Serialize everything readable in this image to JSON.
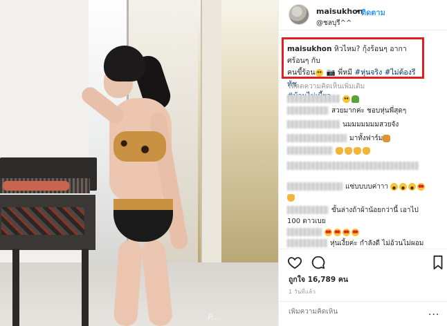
{
  "post": {
    "username": "maisukhon",
    "separator": "•",
    "follow_label": "ติดตาม",
    "location": "@ชลบุรี^^",
    "photo_watermark": "P..."
  },
  "caption": {
    "username": "maisukhon",
    "text_line1": "หิวไหม? กุ้งร้อนๆ อากาศร้อนๆ กับ",
    "text_line2_a": "คนขี้ร้อน",
    "text_line2_b": "📷 พี่หมี",
    "tag1": "#หุ่นจริง",
    "tag2": "#ไม่ต้องรีทัช",
    "tag3": "#บ้านไม่เบี้ยว"
  },
  "load_more": "โหลดความคิดเห็นเพิ่มเติม",
  "comments": [
    {
      "text": ""
    },
    {
      "text": "สวยมากค่ะ ชอบหุ่นพี่สุดๆ"
    },
    {
      "text": "นมมมมมมมสวยจัง"
    },
    {
      "text": "มาทั้งฟาร์ม"
    },
    {
      "text": ""
    },
    {
      "text": "......"
    },
    {
      "text": "แซ่บบบบค่าาา"
    },
    {
      "text": ""
    },
    {
      "text": "ขั้นล่างถ้าผ้าน้อยกว่านี้ เอาไป"
    },
    {
      "text": "100 ดาวเบย"
    },
    {
      "text": ""
    },
    {
      "text": "หุ่นเงี้ยค่ะ กำลังดี ไม่อ้วนไม่ผอม"
    }
  ],
  "likes_text": "ถูกใจ 16,789 คน",
  "time_text": "1 วันที่แล้ว",
  "add_comment_placeholder": "เพิ่มความคิดเห็น",
  "more_label": "...",
  "icons": [
    "heart-icon",
    "comment-icon",
    "bookmark-icon"
  ],
  "colors": {
    "accent": "#3897f0",
    "highlight_box": "#e02020",
    "hashtag": "#003569"
  }
}
